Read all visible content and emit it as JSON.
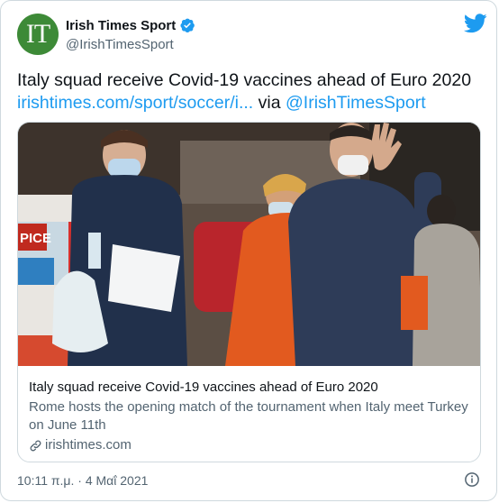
{
  "account": {
    "avatar_text": "IT",
    "display_name": "Irish Times Sport",
    "handle": "@IrishTimesSport",
    "verified": true
  },
  "tweet": {
    "text": "Italy squad receive Covid-19 vaccines ahead of Euro 2020",
    "link": "irishtimes.com/sport/soccer/i...",
    "via_word": "via",
    "via_handle": "@IrishTimesSport"
  },
  "card": {
    "image_sign_text": "PICE",
    "title": "Italy squad receive Covid-19 vaccines ahead of Euro 2020",
    "description": "Rome hosts the opening match of the tournament when Italy meet Turkey on June 11th",
    "domain": "irishtimes.com"
  },
  "footer": {
    "timestamp": "10:11 π.μ. · 4 Μαΐ 2021"
  },
  "icons": [
    "twitter-bird-icon",
    "verified-badge-icon",
    "link-icon",
    "info-icon"
  ],
  "colors": {
    "accent": "#1d9bf0",
    "avatar_bg": "#3d8a37",
    "text_primary": "#0f1419",
    "text_secondary": "#536471",
    "border": "#cfd9de"
  }
}
